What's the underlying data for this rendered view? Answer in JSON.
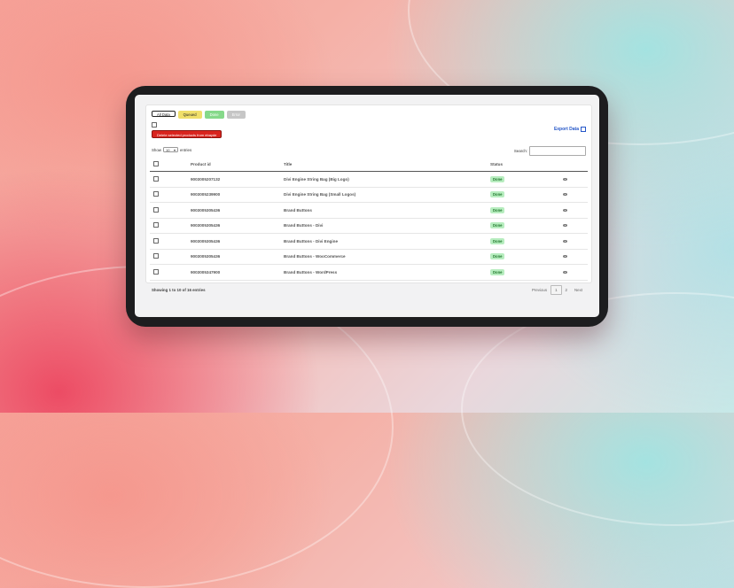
{
  "filters": [
    {
      "label": "All Data",
      "variant": "all"
    },
    {
      "label": "Queued",
      "variant": "queued"
    },
    {
      "label": "Done",
      "variant": "done"
    },
    {
      "label": "Error",
      "variant": "error"
    }
  ],
  "delete_button": "Delete selected products from ebayde",
  "export_link": "Export Data",
  "show": {
    "prefix": "Show",
    "value": "10",
    "suffix": "entries"
  },
  "search": {
    "label": "Search:",
    "placeholder": ""
  },
  "table": {
    "headers": {
      "product_id": "Product id",
      "title": "Title",
      "status": "Status"
    },
    "rows": [
      {
        "product_id": "9003005207132",
        "title": "Divi Engine String Bag (Big Logo)",
        "status": "Done"
      },
      {
        "product_id": "9003005239900",
        "title": "Divi Engine String Bag (Small Logos)",
        "status": "Done"
      },
      {
        "product_id": "9003005305436",
        "title": "Brand Buttons",
        "status": "Done"
      },
      {
        "product_id": "9003005305436",
        "title": "Brand Buttons - Divi",
        "status": "Done"
      },
      {
        "product_id": "9003005305436",
        "title": "Brand Buttons - Divi Engine",
        "status": "Done"
      },
      {
        "product_id": "9003005305436",
        "title": "Brand Buttons - WooCommerce",
        "status": "Done"
      },
      {
        "product_id": "9003005347900",
        "title": "Brand Buttons - WordPress",
        "status": "Done"
      }
    ]
  },
  "footer": {
    "info": "Showing 1 to 10 of 16 entries"
  },
  "pagination": {
    "previous": "Previous",
    "pages": [
      "1",
      "2"
    ],
    "active": "1",
    "next": "Next"
  },
  "colors": {
    "badge_bg": "#b7edbf",
    "badge_text": "#237a2f",
    "delete_red": "#d9241e",
    "link_blue": "#2456c8"
  }
}
